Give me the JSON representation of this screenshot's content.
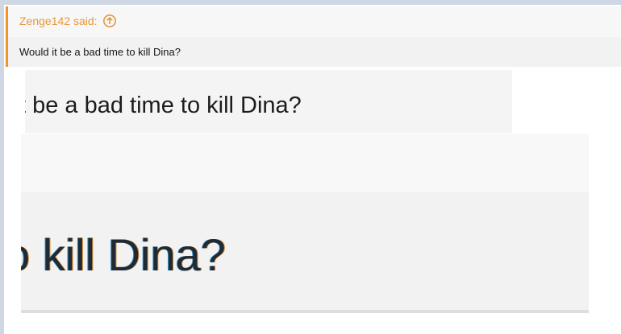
{
  "quote": {
    "author_label": "Zenge142 said:",
    "up_icon": "arrow-up-circle-icon",
    "text": "Would it be a bad time to kill Dina?"
  },
  "zoom_medium": {
    "text": "t be a bad time to kill Dina?"
  },
  "zoom_large": {
    "text": "o kill Dina?"
  },
  "colors": {
    "accent": "#e8963a",
    "quote_border": "#f0932b",
    "chrome_strip": "#cfd7e4"
  }
}
